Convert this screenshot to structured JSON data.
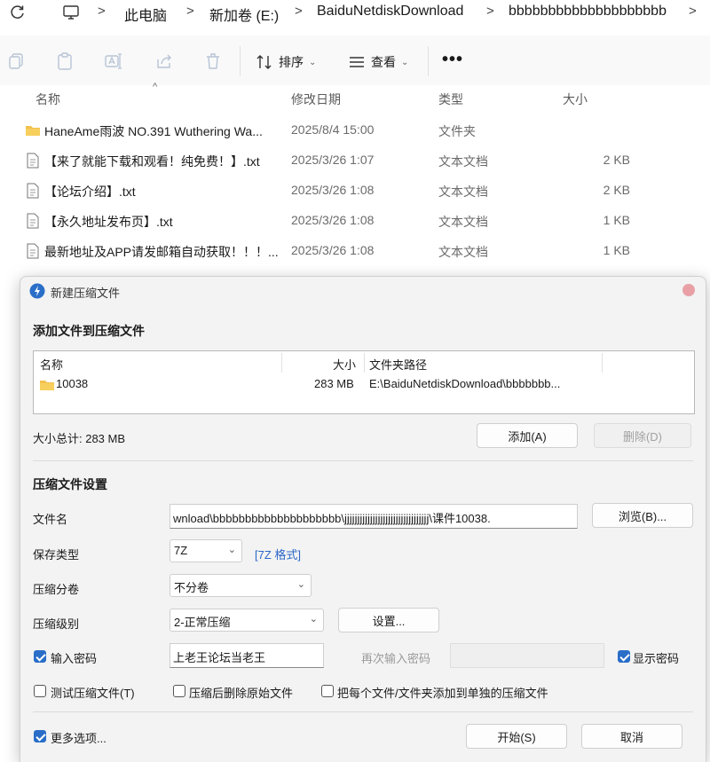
{
  "address_bar": {
    "refresh_icon": "refresh-icon",
    "pc_icon": "computer-icon",
    "crumbs": [
      "此电脑",
      "新加卷 (E:)",
      "BaiduNetdiskDownload",
      "bbbbbbbbbbbbbbbbbbbb"
    ],
    "separator": ">"
  },
  "command_bar": {
    "icons": [
      "copy-icon",
      "paste-icon",
      "rename-icon",
      "share-icon",
      "delete-icon"
    ],
    "sort_label": "排序",
    "view_label": "查看",
    "more_label": "•••"
  },
  "file_list": {
    "columns": {
      "name": "名称",
      "modified": "修改日期",
      "type": "类型",
      "size": "大小"
    },
    "rows": [
      {
        "name": "HaneAme雨波 NO.391 Wuthering Wa...",
        "modified": "2025/8/4 15:00",
        "type": "文件夹",
        "size": "",
        "icon": "folder-icon"
      },
      {
        "name": "【来了就能下载和观看！纯免费！】.txt",
        "modified": "2025/3/26 1:07",
        "type": "文本文档",
        "size": "2 KB",
        "icon": "text-file-icon"
      },
      {
        "name": "【论坛介绍】.txt",
        "modified": "2025/3/26 1:08",
        "type": "文本文档",
        "size": "2 KB",
        "icon": "text-file-icon"
      },
      {
        "name": "【永久地址发布页】.txt",
        "modified": "2025/3/26 1:08",
        "type": "文本文档",
        "size": "1 KB",
        "icon": "text-file-icon"
      },
      {
        "name": "最新地址及APP请发邮箱自动获取！！！...",
        "modified": "2025/3/26 1:08",
        "type": "文本文档",
        "size": "1 KB",
        "icon": "text-file-icon"
      }
    ]
  },
  "dialog": {
    "title": "新建压缩文件",
    "add_section_title": "添加文件到压缩文件",
    "table": {
      "col_name": "名称",
      "col_size": "大小",
      "col_path": "文件夹路径",
      "rows": [
        {
          "name": "10038",
          "size": "283 MB",
          "path": "E:\\BaiduNetdiskDownload\\bbbbbbb..."
        }
      ]
    },
    "total_size": "大小总计: 283 MB",
    "add_button": "添加(A)",
    "delete_button": "删除(D)",
    "settings_section_title": "压缩文件设置",
    "filename_label": "文件名",
    "filename_value": "wnload\\bbbbbbbbbbbbbbbbbbbb\\jjjjjjjjjjjjjjjjjjjjjjjjjjjjjjjjj\\课件10038.",
    "browse_button": "浏览(B)...",
    "save_type_label": "保存类型",
    "save_type_value": "7Z",
    "save_type_link": "[7Z 格式]",
    "split_label": "压缩分卷",
    "split_value": "不分卷",
    "level_label": "压缩级别",
    "level_value": "2-正常压缩",
    "settings_button": "设置...",
    "password_label": "输入密码",
    "password_checked": true,
    "password_value": "上老王论坛当老王",
    "repeat_password_label": "再次输入密码",
    "show_password_label": "显示密码",
    "show_password_checked": true,
    "test_label": "测试压缩文件(T)",
    "test_checked": false,
    "delete_after_label": "压缩后删除原始文件",
    "delete_after_checked": false,
    "separate_label": "把每个文件/文件夹添加到单独的压缩文件",
    "separate_checked": false,
    "more_options_label": "更多选项...",
    "more_options_checked": true,
    "start_button": "开始(S)",
    "cancel_button": "取消"
  },
  "colors": {
    "accent": "#2a6ec8",
    "folder": "#f2c14e",
    "link": "#2b67c7",
    "close_dot": "#e8a0a6"
  }
}
